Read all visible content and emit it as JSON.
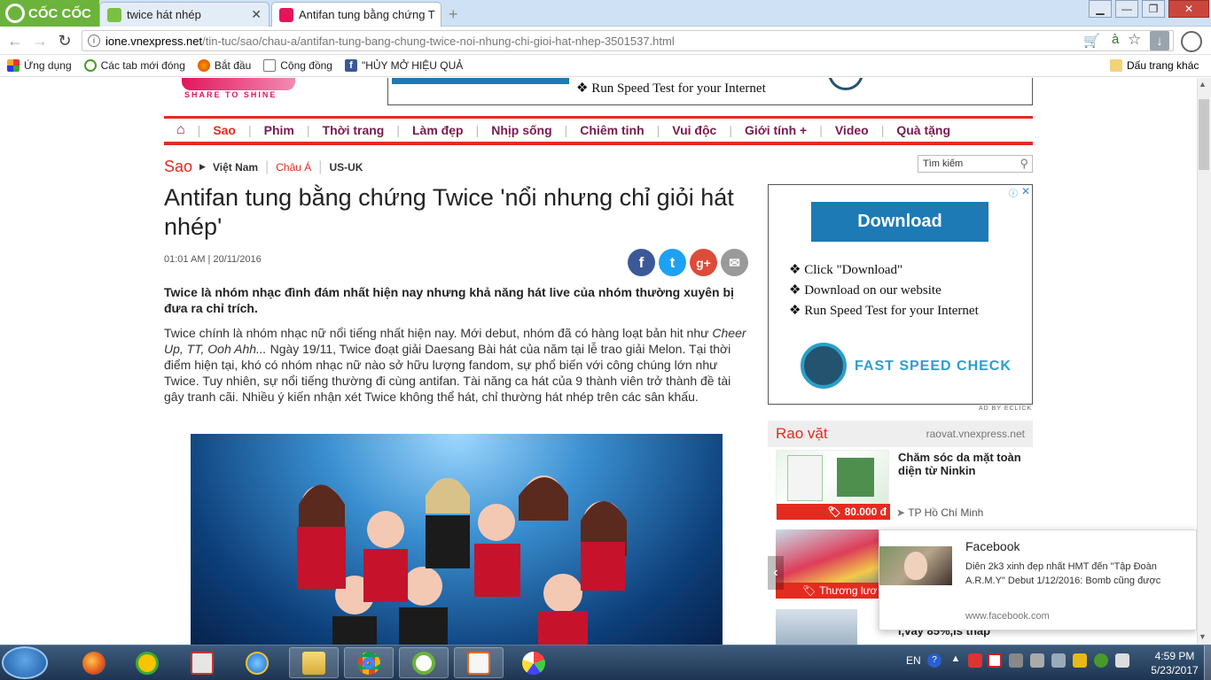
{
  "browser": {
    "brand": "CỐC CỐC",
    "tabs": [
      {
        "title": "twice hát nhép"
      },
      {
        "title": "Antifan tung bằng chứng T"
      }
    ],
    "url_domain": "ione.vnexpress.net",
    "url_path": "/tin-tuc/sao/chau-a/antifan-tung-bang-chung-twice-noi-nhung-chi-gioi-hat-nhep-3501537.html",
    "bookmarks": [
      "Ứng dụng",
      "Các tab mới đóng",
      "Bắt đầu",
      "Cộng đồng",
      "\"HỦY MỞ HIỆU QUẢ"
    ],
    "other_bookmarks": "Dấu trang khác",
    "lang_indicator": "à"
  },
  "site": {
    "logo_tagline": "SHARE TO SHINE",
    "top_ad_text": "❖ Run Speed Test for your Internet",
    "nav": [
      "Sao",
      "Phim",
      "Thời trang",
      "Làm đẹp",
      "Nhịp sống",
      "Chiêm tinh",
      "Vui độc",
      "Giới tính +",
      "Video",
      "Quà tặng"
    ],
    "section": "Sao",
    "subsections": [
      "Việt Nam",
      "Châu Á",
      "US-UK"
    ],
    "search_placeholder": "Tìm kiếm"
  },
  "article": {
    "title": "Antifan tung bằng chứng Twice 'nổi nhưng chỉ giỏi hát nhép'",
    "timestamp": "01:01 AM | 20/11/2016",
    "lead": "Twice là nhóm nhạc đình đám nhất hiện nay nhưng khả năng hát live của nhóm thường xuyên bị đưa ra chỉ trích.",
    "body_1": "Twice chính là nhóm nhạc nữ nổi tiếng nhất hiện nay. Mới debut, nhóm đã có hàng loạt bản hit như ",
    "body_italic": "Cheer Up, TT, Ooh Ahh...",
    "body_2": " Ngày 19/11, Twice đoạt giải Daesang Bài hát của năm tại lễ trao giải Melon. Tại thời điểm hiện tại, khó có nhóm nhạc nữ nào sở hữu lượng fandom, sự phổ biến với công chúng lớn như Twice. Tuy nhiên, sự nổi tiếng thường đi cùng antifan. Tài năng ca hát của 9 thành viên trở thành đề tài gây tranh cãi. Nhiều ý kiến nhận xét Twice không thể hát, chỉ thường hát nhép trên các sân khấu.",
    "share_icons": [
      "f",
      "t",
      "g+",
      "✉"
    ]
  },
  "sidebar_ad": {
    "button": "Download",
    "lines": [
      "❖ Click \"Download\"",
      "❖ Download on our website",
      "❖ Run Speed Test for your Internet"
    ],
    "brand": "FAST SPEED CHECK",
    "ad_by": "AD BY ECLICK"
  },
  "classifieds": {
    "title": "Rao vặt",
    "source": "raovat.vnexpress.net",
    "item1_title": "Chăm sóc da mặt toàn diện từ Ninkin",
    "item1_price": "80.000 đ",
    "item1_location": "TP Hồ Chí Minh",
    "item2_badge": "Thương lươ",
    "item3_partial": "i,vay 85%,ls thấp"
  },
  "notification": {
    "source": "Facebook",
    "text": "Diên 2k3 xinh đẹp nhất HMT đến \"Tập Đoàn A.R.M.Y\" Debut 1/12/2016: Bomb cũng được",
    "url": "www.facebook.com"
  },
  "taskbar": {
    "lang": "EN",
    "time": "4:59 PM",
    "date": "5/23/2017"
  },
  "colors": {
    "accent_red": "#e42b1f",
    "nav_purple": "#7a1a4f",
    "brand_green": "#6bb33a",
    "download_blue": "#1d7ab5"
  }
}
